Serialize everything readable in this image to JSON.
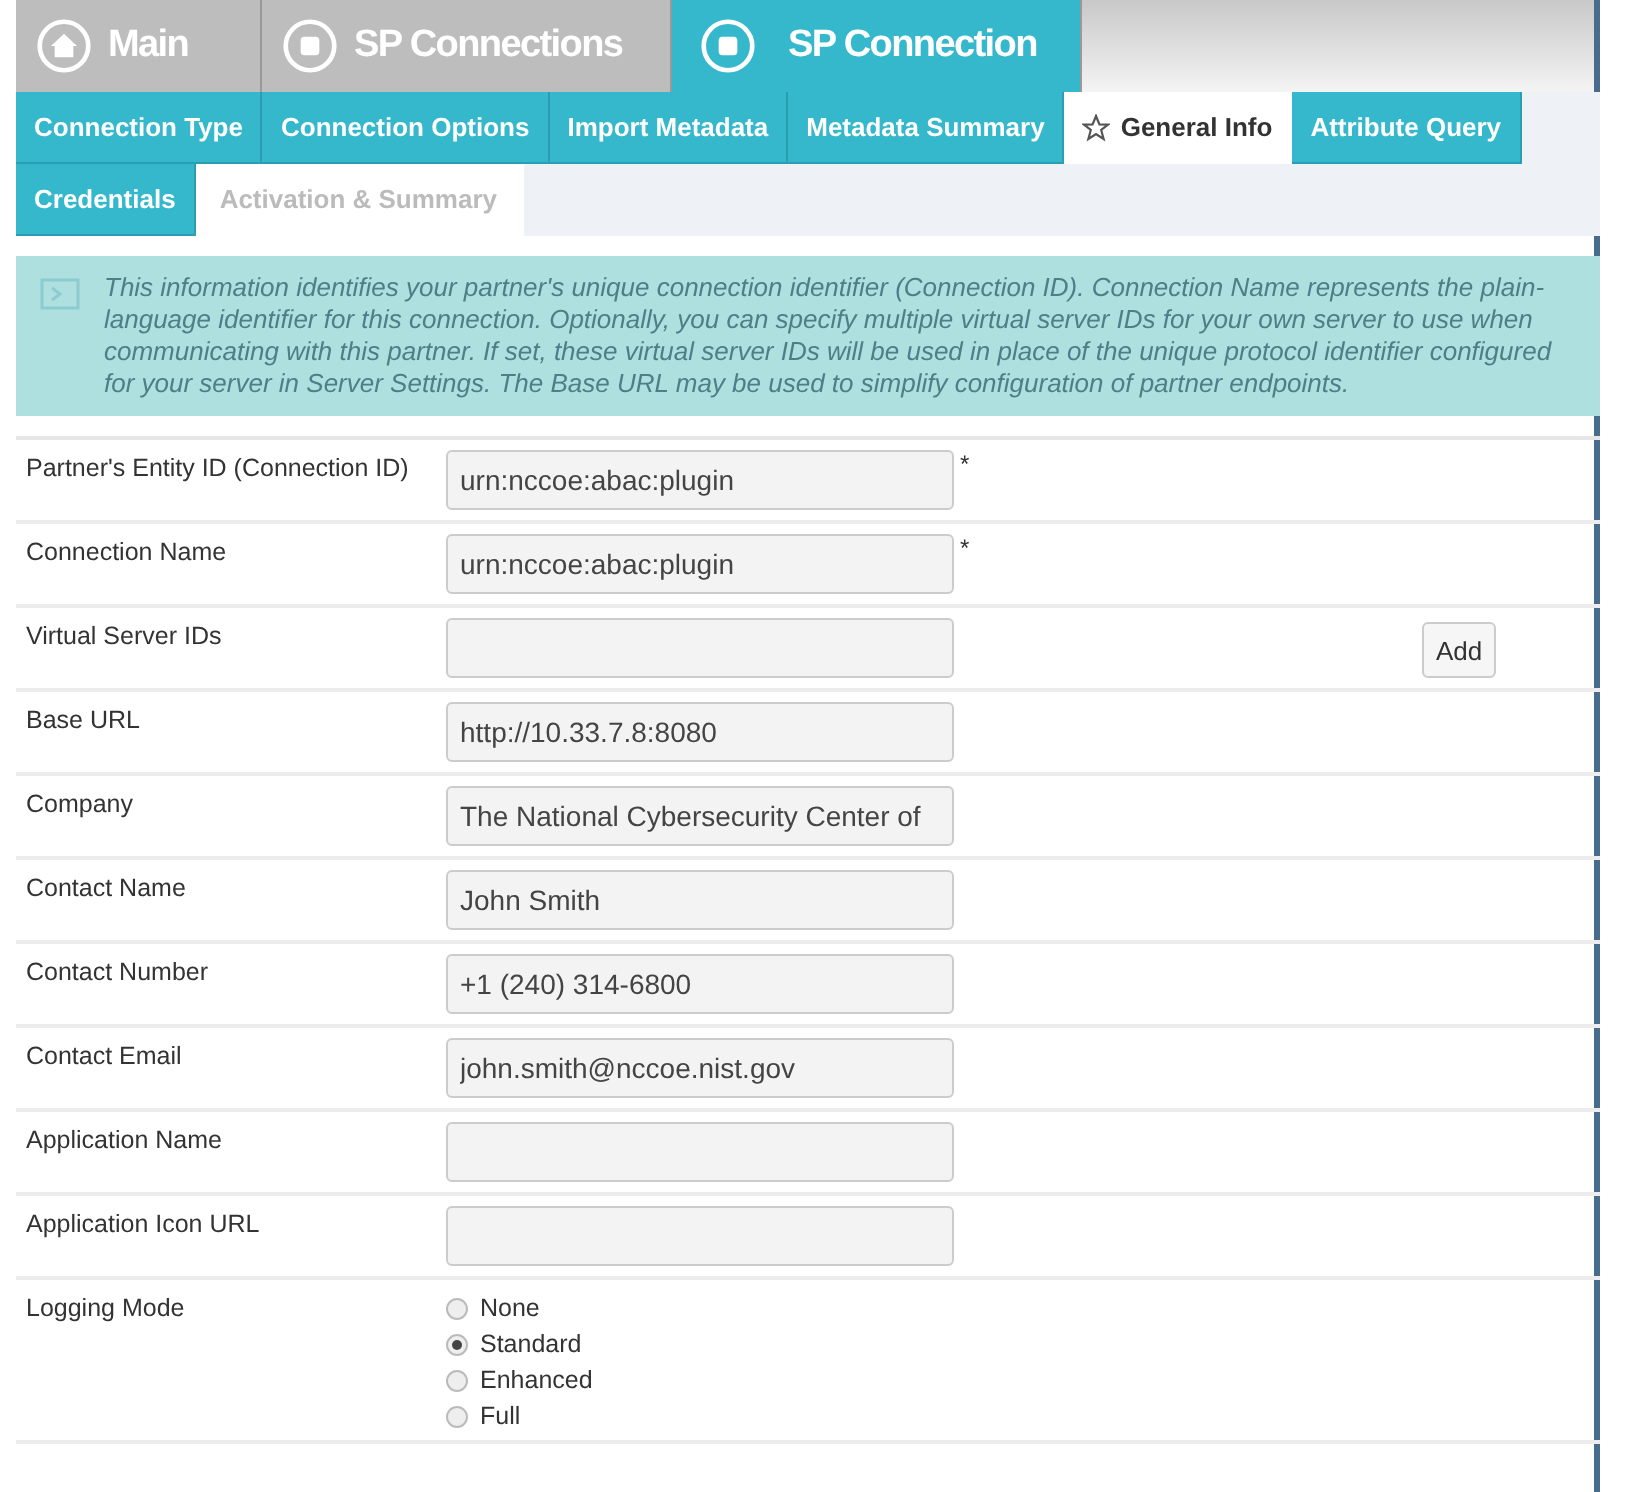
{
  "breadcrumbs": [
    {
      "label": "Main",
      "kind": "home",
      "selected": false
    },
    {
      "label": "SP Connections",
      "kind": "item",
      "selected": false
    },
    {
      "label": "SP Connection",
      "kind": "item",
      "selected": true
    }
  ],
  "tabs": [
    {
      "label": "Connection Type",
      "selected": false,
      "disabled": false
    },
    {
      "label": "Connection Options",
      "selected": false,
      "disabled": false
    },
    {
      "label": "Import Metadata",
      "selected": false,
      "disabled": false
    },
    {
      "label": "Metadata Summary",
      "selected": false,
      "disabled": false
    },
    {
      "label": "General Info",
      "selected": true,
      "disabled": false
    },
    {
      "label": "Attribute Query",
      "selected": false,
      "disabled": false
    },
    {
      "label": "Credentials",
      "selected": false,
      "disabled": false
    },
    {
      "label": "Activation & Summary",
      "selected": false,
      "disabled": true
    }
  ],
  "info": "This information identifies your partner's unique connection identifier (Connection ID). Connection Name represents the plain-language identifier for this connection. Optionally, you can specify multiple virtual server IDs for your own server to use when communicating with this partner. If set, these virtual server IDs will be used in place of the unique protocol identifier configured for your server in Server Settings. The Base URL may be used to simplify configuration of partner endpoints.",
  "fields": [
    {
      "kind": "text",
      "label": "Partner's Entity ID (Connection ID)",
      "value": "urn:nccoe:abac:plugin",
      "required": "*"
    },
    {
      "kind": "text",
      "label": "Connection Name",
      "value": "urn:nccoe:abac:plugin",
      "required": "*"
    },
    {
      "kind": "text",
      "label": "Virtual Server IDs",
      "button": "Add"
    },
    {
      "kind": "text",
      "label": "Base URL",
      "value": "http://10.33.7.8:8080"
    },
    {
      "kind": "text",
      "label": "Company",
      "value": "The National Cybersecurity Center of"
    },
    {
      "kind": "text",
      "label": "Contact Name",
      "value": "John Smith"
    },
    {
      "kind": "text",
      "label": "Contact Number",
      "value": "+1 (240) 314-6800"
    },
    {
      "kind": "text",
      "label": "Contact Email",
      "value": "john.smith@nccoe.nist.gov"
    },
    {
      "kind": "text",
      "label": "Application Name"
    },
    {
      "kind": "text",
      "label": "Application Icon URL"
    },
    {
      "kind": "radio",
      "label": "Logging Mode",
      "options": [
        {
          "label": "None",
          "selected": false
        },
        {
          "label": "Standard",
          "selected": true
        },
        {
          "label": "Enhanced",
          "selected": false
        },
        {
          "label": "Full",
          "selected": false
        }
      ]
    }
  ]
}
